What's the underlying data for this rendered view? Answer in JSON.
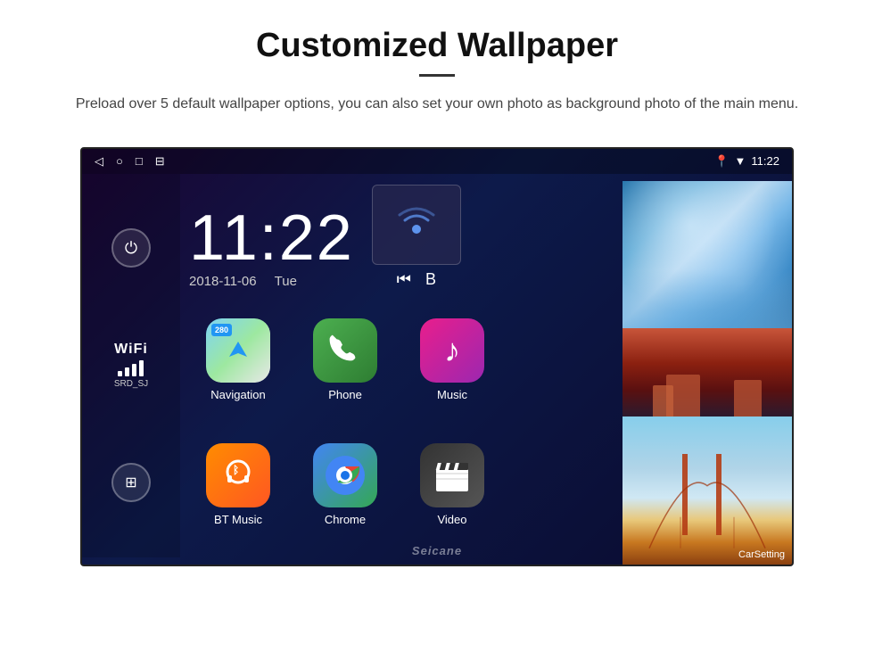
{
  "header": {
    "title": "Customized Wallpaper",
    "subtitle": "Preload over 5 default wallpaper options, you can also set your own photo as background photo of the main menu."
  },
  "statusBar": {
    "time": "11:22",
    "navIcons": [
      "◁",
      "○",
      "□",
      "⊟"
    ],
    "rightIcons": [
      "📍",
      "▼"
    ]
  },
  "clock": {
    "time": "11:22",
    "date": "2018-11-06",
    "day": "Tue"
  },
  "wifi": {
    "label": "WiFi",
    "ssid": "SRD_SJ"
  },
  "apps": [
    {
      "id": "navigation",
      "label": "Navigation",
      "badge": "280",
      "type": "navigation"
    },
    {
      "id": "phone",
      "label": "Phone",
      "type": "phone"
    },
    {
      "id": "music",
      "label": "Music",
      "type": "music"
    },
    {
      "id": "bt-music",
      "label": "BT Music",
      "type": "bt"
    },
    {
      "id": "chrome",
      "label": "Chrome",
      "type": "chrome"
    },
    {
      "id": "video",
      "label": "Video",
      "type": "video"
    }
  ],
  "wallpapers": {
    "labels": [
      "CarSetting"
    ]
  },
  "watermark": "Seicane"
}
